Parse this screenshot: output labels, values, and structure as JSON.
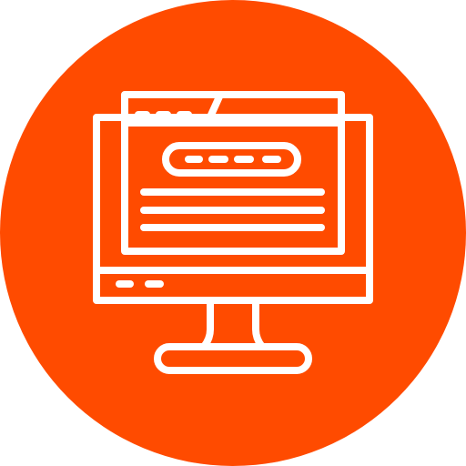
{
  "icon": {
    "name": "computer-browser-icon",
    "colors": {
      "background": "#ffffff",
      "circle": "#FF4B00",
      "stroke": "#ffffff"
    },
    "parts": [
      "monitor-icon",
      "browser-window-icon",
      "search-bar-icon",
      "text-lines-icon",
      "monitor-stand-icon"
    ]
  }
}
